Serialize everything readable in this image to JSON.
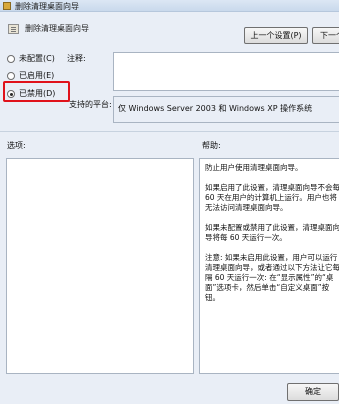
{
  "window": {
    "title": "删除清理桌面向导"
  },
  "header": {
    "policy_name": "删除清理桌面向导",
    "prev_label": "上一个设置(P)",
    "next_label": "下一个"
  },
  "state_options": [
    {
      "label": "未配置(C)",
      "checked": false
    },
    {
      "label": "已启用(E)",
      "checked": false
    },
    {
      "label": "已禁用(D)",
      "checked": true
    }
  ],
  "comment": {
    "label": "注释:",
    "value": ""
  },
  "supported": {
    "label": "支持的平台:",
    "value": "仅 Windows Server 2003 和 Windows XP 操作系统"
  },
  "options": {
    "label": "选项:"
  },
  "help": {
    "label": "帮助:",
    "text": "防止用户使用清理桌面向导。\n\n如果启用了此设置，清理桌面向导不会每 60 天在用户的计算机上运行。用户也将无法访问清理桌面向导。\n\n如果未配置或禁用了此设置，清理桌面向导将每 60 天运行一次。\n\n注意: 如果未启用此设置，用户可以运行清理桌面向导，或者通过以下方法让它每隔 60 天运行一次: 在“显示属性”的“桌面”选项卡，然后单击“自定义桌面”按钮。"
  },
  "footer": {
    "ok_label": "确定"
  }
}
